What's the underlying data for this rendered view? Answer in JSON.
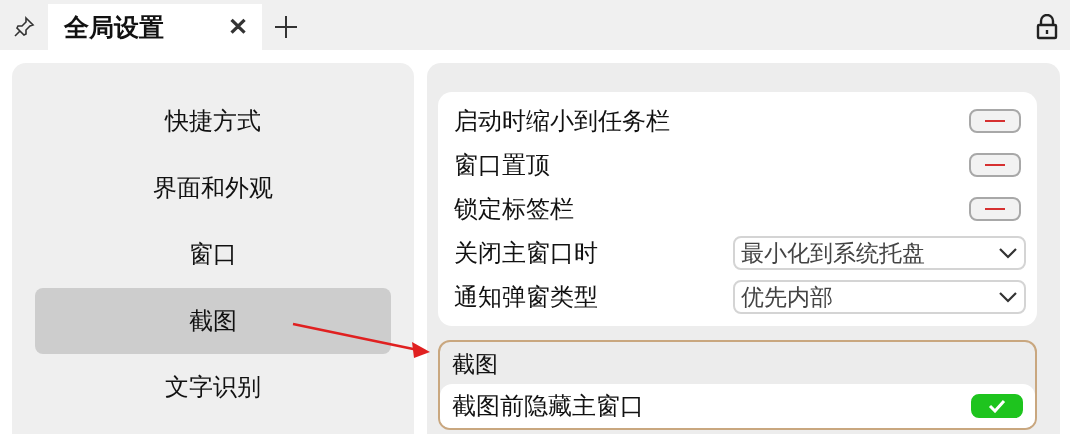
{
  "tabs": [
    {
      "label": "全局设置",
      "selected": true,
      "close": "✕"
    }
  ],
  "nav": {
    "items": [
      {
        "label": "快捷方式",
        "selected": false
      },
      {
        "label": "界面和外观",
        "selected": false
      },
      {
        "label": "窗口",
        "selected": false
      },
      {
        "label": "截图",
        "selected": true
      },
      {
        "label": "文字识别",
        "selected": false
      }
    ]
  },
  "sections": [
    {
      "highlighted": false,
      "settings": [
        {
          "kind": "toggle",
          "label": "启动时缩小到任务栏",
          "on": false
        },
        {
          "kind": "toggle",
          "label": "窗口置顶",
          "on": false
        },
        {
          "kind": "toggle",
          "label": "锁定标签栏",
          "on": false
        },
        {
          "kind": "dropdown",
          "label": "关闭主窗口时",
          "value": "最小化到系统托盘"
        },
        {
          "kind": "dropdown",
          "label": "通知弹窗类型",
          "value": "优先内部"
        }
      ]
    },
    {
      "title": "截图",
      "highlighted": true,
      "settings": [
        {
          "kind": "toggle",
          "label": "截图前隐藏主窗口",
          "on": true
        }
      ]
    }
  ]
}
